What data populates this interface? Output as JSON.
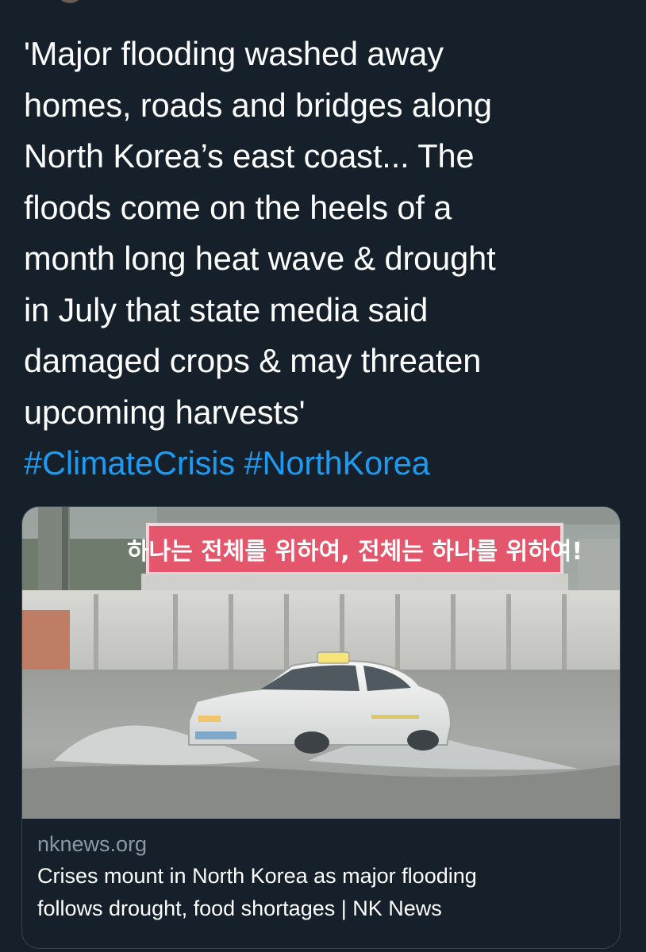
{
  "tweet": {
    "text_lines": [
      "'Major flooding washed away",
      "homes, roads and bridges along",
      "North Korea’s east coast... The",
      "floods come on the heels of a",
      "month long heat wave & drought",
      "in July that state media said",
      "damaged crops & may threaten",
      "upcoming harvests'"
    ],
    "hashtags": [
      "#ClimateCrisis",
      "#NorthKorea"
    ],
    "hashtag_color": "#1d9bf0"
  },
  "link_card": {
    "domain": "nknews.org",
    "title_lines": [
      "Crises mount in North Korea as major flooding",
      "follows drought, food shortages | NK News"
    ],
    "image_banner_text": "하나는 전체를 위하여, 전체는 하나를 위하여!"
  },
  "colors": {
    "background": "#15202b",
    "text": "#ffffff",
    "secondary_text": "#8b98a5",
    "card_border": "#38444d"
  }
}
